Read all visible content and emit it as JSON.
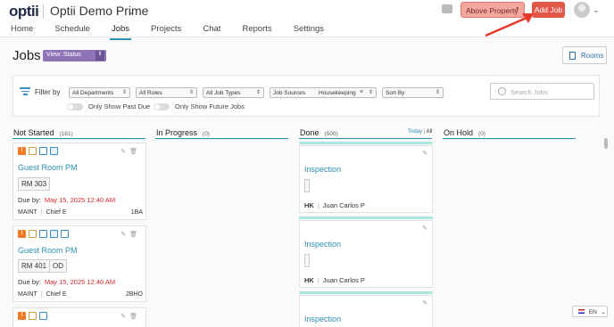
{
  "app": {
    "logo": "optii",
    "property_name": "Optii Demo Prime"
  },
  "nav": [
    "Home",
    "Schedule",
    "Jobs",
    "Projects",
    "Chat",
    "Reports",
    "Settings"
  ],
  "nav_active": "Jobs",
  "header": {
    "above_property": "Above Property",
    "add_job": "Add Job"
  },
  "page": {
    "title": "Jobs",
    "view_status": "View: Status",
    "rooms": "Rooms"
  },
  "filter": {
    "label": "Filter by",
    "departments": "All Departments",
    "roles": "All Roles",
    "job_types": "All Job Types",
    "job_sources": "Job Sources",
    "housekeeping": "Housekeeping",
    "sort_by": "Sort By",
    "search_placeholder": "Search Jobs",
    "past_due": "Only Show Past Due",
    "future_jobs": "Only Show Future Jobs"
  },
  "columns": {
    "not_started": {
      "label": "Not Started",
      "count": "(181)"
    },
    "in_progress": {
      "label": "In Progress",
      "count": "(0)"
    },
    "done": {
      "label": "Done",
      "count": "(500)",
      "today": "Today",
      "sep": "|",
      "all": "All"
    },
    "on_hold": {
      "label": "On Hold",
      "count": "(0)"
    }
  },
  "not_started_cards": [
    {
      "title": "Guest Room PM",
      "rooms": [
        "RM 303"
      ],
      "due_label": "Due by:",
      "due": "May 15, 2025 12:40 AM",
      "dept": "MAINT",
      "assignee": "Chief E",
      "code": "1BA"
    },
    {
      "title": "Guest Room PM",
      "rooms": [
        "RM 401",
        "OD"
      ],
      "due_label": "Due by:",
      "due": "May 15, 2025 12:40 AM",
      "dept": "MAINT",
      "assignee": "Chief E",
      "code": "2BHO"
    }
  ],
  "done_cards": [
    {
      "title": "Inspection",
      "dept": "HK",
      "assignee": "Juan Carlos P"
    },
    {
      "title": "Inspection",
      "dept": "HK",
      "assignee": "Juan Carlos P"
    },
    {
      "title": "Inspection"
    }
  ],
  "language": "EN",
  "colors": {
    "accent": "#2a8fb0",
    "add_job": "#e4584a",
    "above_property": "#f4a79f",
    "view_status": "#8e74b6",
    "due_red": "#d9262b",
    "annotation_arrow": "#e8382a"
  }
}
